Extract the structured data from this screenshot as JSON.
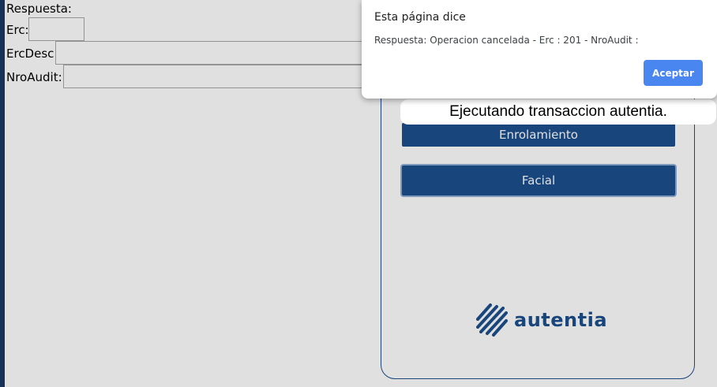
{
  "form": {
    "respuesta_label": "Respuesta:",
    "erc_label": "Erc:",
    "ercdesc_label": "ErcDesc:",
    "nroaudit_label": "NroAudit:"
  },
  "panel": {
    "enrolamiento_label": "Enrolamiento",
    "facial_label": "Facial",
    "logo_text": "autentia"
  },
  "toast": {
    "message": "Ejecutando transaccion autentia."
  },
  "dialog": {
    "title": "Esta página dice",
    "message": "Respuesta: Operacion cancelada - Erc : 201 - NroAudit :",
    "accept_label": "Aceptar"
  },
  "colors": {
    "brand_blue": "#1c4f8c",
    "dialog_button": "#4a86f0"
  }
}
